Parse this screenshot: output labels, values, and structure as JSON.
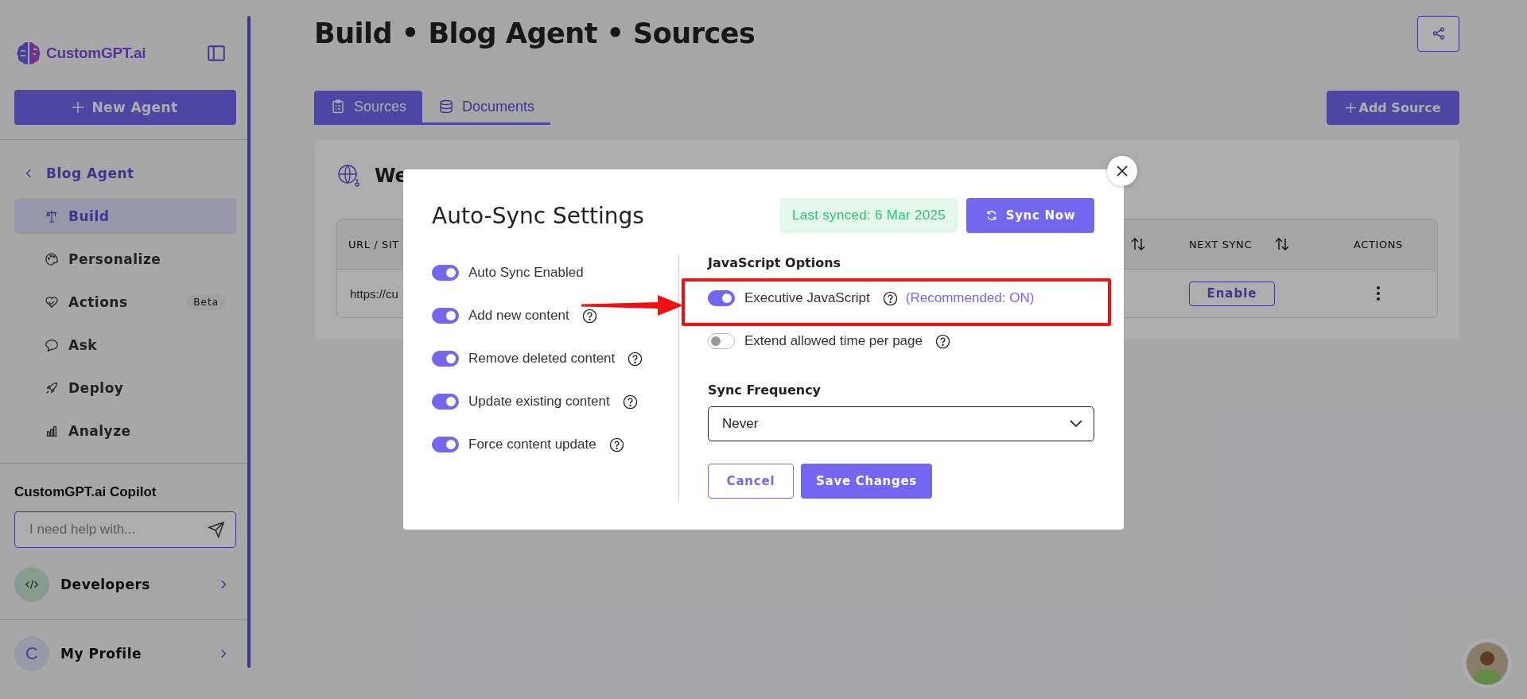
{
  "sidebar": {
    "brand": "CustomGPT.ai",
    "new_agent_button": "New Agent",
    "back_link": "Blog Agent",
    "items": [
      {
        "label": "Build",
        "selected": true
      },
      {
        "label": "Personalize",
        "selected": false
      },
      {
        "label": "Actions",
        "selected": false,
        "badge": "Beta"
      },
      {
        "label": "Ask",
        "selected": false
      },
      {
        "label": "Deploy",
        "selected": false
      },
      {
        "label": "Analyze",
        "selected": false
      }
    ],
    "copilot": {
      "title": "CustomGPT.ai Copilot",
      "placeholder": "I need help with..."
    },
    "developers": "Developers",
    "profile": {
      "initial": "C",
      "label": "My Profile"
    }
  },
  "page": {
    "title": "Build • Blog Agent • Sources",
    "tabs": [
      {
        "label": "Sources",
        "selected": true
      },
      {
        "label": "Documents",
        "selected": false
      }
    ],
    "add_source_button": "Add Source",
    "card": {
      "heading": "We",
      "table": {
        "columns": [
          {
            "label": "URL / SIT",
            "sortable": false
          },
          {
            "sortable": true
          },
          {
            "label": "NEXT SYNC",
            "sortable": true
          },
          {
            "label": "ACTIONS",
            "sortable": false
          }
        ],
        "rows": [
          {
            "url": "https://cu",
            "next_sync": "Enable"
          }
        ]
      }
    }
  },
  "modal": {
    "title": "Auto-Sync Settings",
    "last_synced": "Last synced: 6 Mar 2025",
    "sync_button": "Sync Now",
    "options": [
      {
        "label": "Auto Sync Enabled",
        "on": true,
        "help": false
      },
      {
        "label": "Add new content",
        "on": true,
        "help": true
      },
      {
        "label": "Remove deleted content",
        "on": true,
        "help": true
      },
      {
        "label": "Update existing content",
        "on": true,
        "help": true
      },
      {
        "label": "Force content update",
        "on": true,
        "help": true
      }
    ],
    "js_options": {
      "title": "JavaScript Options",
      "options": [
        {
          "label": "Executive JavaScript",
          "on": true,
          "help": true,
          "note": "(Recommended: ON)"
        },
        {
          "label": "Extend allowed time per page",
          "on": false,
          "help": true
        }
      ]
    },
    "frequency": {
      "label": "Sync Frequency",
      "value": "Never"
    },
    "cancel_button": "Cancel",
    "save_button": "Save Changes"
  }
}
